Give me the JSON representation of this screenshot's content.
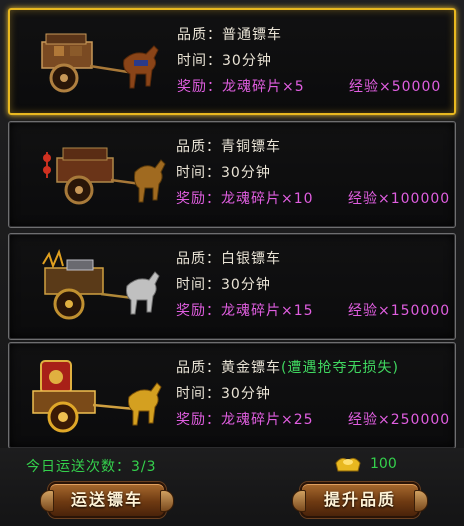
{
  "carts": [
    {
      "quality_label": "品质：",
      "quality": "普通镖车",
      "note": "",
      "time": "时间：30分钟",
      "reward": "奖励：龙魂碎片×5",
      "exp": "经验×50000",
      "selected": true
    },
    {
      "quality_label": "品质：",
      "quality": "青铜镖车",
      "note": "",
      "time": "时间：30分钟",
      "reward": "奖励：龙魂碎片×10",
      "exp": "经验×100000",
      "selected": false
    },
    {
      "quality_label": "品质：",
      "quality": "白银镖车",
      "note": "",
      "time": "时间：30分钟",
      "reward": "奖励：龙魂碎片×15",
      "exp": "经验×150000",
      "selected": false
    },
    {
      "quality_label": "品质：",
      "quality": "黄金镖车",
      "note": "(遭遇抢夺无损失)",
      "time": "时间：30分钟",
      "reward": "奖励：龙魂碎片×25",
      "exp": "经验×250000",
      "selected": false
    }
  ],
  "footer": {
    "runs_label": "今日运送次数：3/3",
    "gold_amount": "100",
    "escort_button": "运送镖车",
    "upgrade_button": "提升品质"
  },
  "colors": {
    "selected_border": "#e8b820",
    "reward_text": "#e05ee0",
    "green_text": "#34d04c"
  }
}
